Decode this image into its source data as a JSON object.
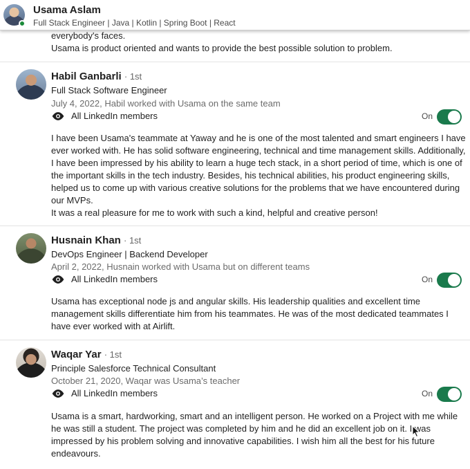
{
  "header": {
    "name": "Usama Aslam",
    "headline": "Full Stack Engineer | Java | Kotlin | Spring Boot | React"
  },
  "partial_recommendation": {
    "lines": [
      "everybody's faces.",
      "Usama is product oriented and wants to provide the best possible solution to problem."
    ]
  },
  "recommendations": [
    {
      "name": "Habil Ganbarli",
      "degree": "· 1st",
      "headline": "Full Stack Software Engineer",
      "meta": "July 4, 2022, Habil worked with Usama on the same team",
      "visibility": "All LinkedIn members",
      "toggle_label": "On",
      "paragraphs": [
        "I have been Usama's teammate at Yaway and he is one of the most talented and smart engineers I have ever worked with. He has solid software engineering, technical and time management skills. Additionally, I have been impressed by his ability to learn a huge tech stack, in a short period of time, which is one of the important skills in the tech industry. Besides, his technical abilities, his product engineering skills, helped us to come up with various creative solutions for the problems that we have encountered during our MVPs.",
        "It was a real pleasure for me to work with such a kind, helpful and creative person!"
      ]
    },
    {
      "name": "Husnain Khan",
      "degree": "· 1st",
      "headline": "DevOps Engineer | Backend Developer",
      "meta": "April 2, 2022, Husnain worked with Usama but on different teams",
      "visibility": "All LinkedIn members",
      "toggle_label": "On",
      "paragraphs": [
        "Usama has exceptional node js and angular skills. His leadership qualities and excellent time management skills differentiate him from his teammates. He was of the most dedicated teammates I have ever worked with at Airlift."
      ]
    },
    {
      "name": "Waqar Yar",
      "degree": "· 1st",
      "headline": "Principle Salesforce Technical Consultant",
      "meta": "October 21, 2020, Waqar was Usama’s teacher",
      "visibility": "All LinkedIn members",
      "toggle_label": "On",
      "paragraphs": [
        "Usama is a smart, hardworking, smart and an intelligent person. He worked on a Project with me while he was still a student. The project was completed by him and he did an excellent job on it. I was impressed by his problem solving and innovative capabilities. I wish him all the best for his future endeavours."
      ]
    }
  ],
  "colors": {
    "toggle_on": "#1a7a4c",
    "online": "#1b8a3a",
    "meta_text": "#6b6b6b"
  },
  "icons": [
    "eye-icon",
    "online-status-icon",
    "cursor-icon"
  ]
}
